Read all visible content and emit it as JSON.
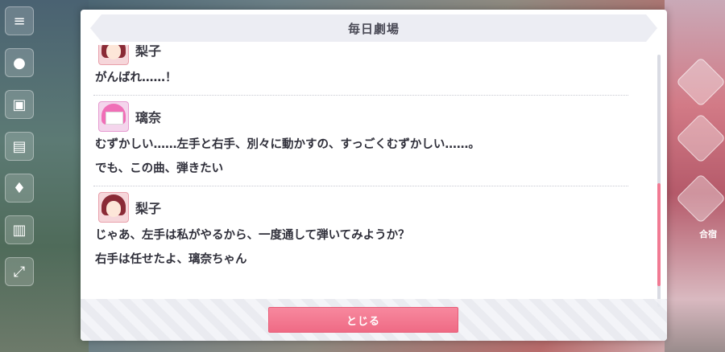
{
  "dialog": {
    "title": "毎日劇場",
    "close_label": "とじる"
  },
  "entries": [
    {
      "speaker": "梨子",
      "avatar_icon": "riko-avatar",
      "lines": [
        "がんばれ……！"
      ]
    },
    {
      "speaker": "璃奈",
      "avatar_icon": "rina-avatar",
      "lines": [
        "むずかしい……左手と右手、別々に動かすの、すっごくむずかしい……。",
        "でも、この曲、弾きたい"
      ]
    },
    {
      "speaker": "梨子",
      "avatar_icon": "riko-avatar",
      "lines": [
        "じゃあ、左手は私がやるから、一度通して弾いてみようか？",
        "右手は任せたよ、璃奈ちゃん"
      ]
    }
  ],
  "sidebar": {
    "icons": [
      "menu-icon",
      "chat-icon",
      "event-icon",
      "gift-icon",
      "mail-icon",
      "chest-icon",
      "expand-icon"
    ]
  },
  "right": {
    "label": "合宿"
  },
  "colors": {
    "accent": "#ef6b85",
    "header_bg": "#ecedf3"
  }
}
